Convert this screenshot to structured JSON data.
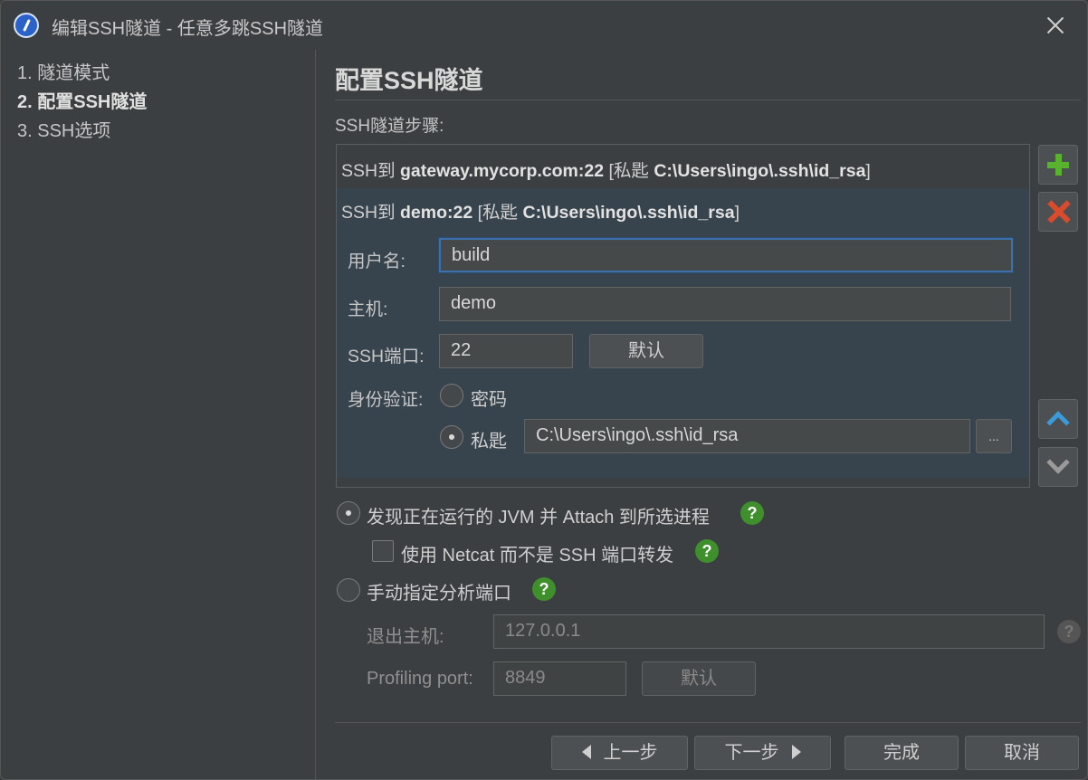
{
  "window": {
    "title": "编辑SSH隧道 - 任意多跳SSH隧道"
  },
  "sidebar": {
    "steps": [
      {
        "label": "1. 隧道模式"
      },
      {
        "label": "2. 配置SSH隧道",
        "active": true
      },
      {
        "label": "3. SSH选项"
      }
    ]
  },
  "main": {
    "heading": "配置SSH隧道",
    "steps_label": "SSH隧道步骤:",
    "tunnel_steps": [
      {
        "prefix": "SSH到 ",
        "host": "gateway.mycorp.com:22",
        "mid": " [私匙 ",
        "key": "C:\\Users\\ingo\\.ssh\\id_rsa",
        "suffix": "]"
      },
      {
        "prefix": "SSH到 ",
        "host": "demo:22",
        "mid": " [私匙 ",
        "key": "C:\\Users\\ingo\\.ssh\\id_rsa",
        "suffix": "]"
      }
    ],
    "form": {
      "username_label": "用户名:",
      "username_value": "build",
      "host_label": "主机:",
      "host_value": "demo",
      "port_label": "SSH端口:",
      "port_value": "22",
      "default_button": "默认",
      "auth_label": "身份验证:",
      "auth_password": "密码",
      "auth_key": "私匙",
      "key_path": "C:\\Users\\ingo\\.ssh\\id_rsa",
      "browse_button": "..."
    },
    "options": {
      "discover_jvm": "发现正在运行的 JVM 并 Attach 到所选进程",
      "use_netcat": "使用 Netcat 而不是 SSH 端口转发",
      "manual_port": "手动指定分析端口",
      "exit_host_label": "退出主机:",
      "exit_host_value": "127.0.0.1",
      "profiling_port_label": "Profiling port:",
      "profiling_port_value": "8849",
      "default_button": "默认",
      "help_glyph": "?"
    }
  },
  "footer": {
    "back": "上一步",
    "next": "下一步",
    "finish": "完成",
    "cancel": "取消"
  },
  "colors": {
    "accent": "#3d6fa8",
    "add": "#59b22d",
    "remove": "#d94b2c",
    "help": "#3f8f2d"
  }
}
